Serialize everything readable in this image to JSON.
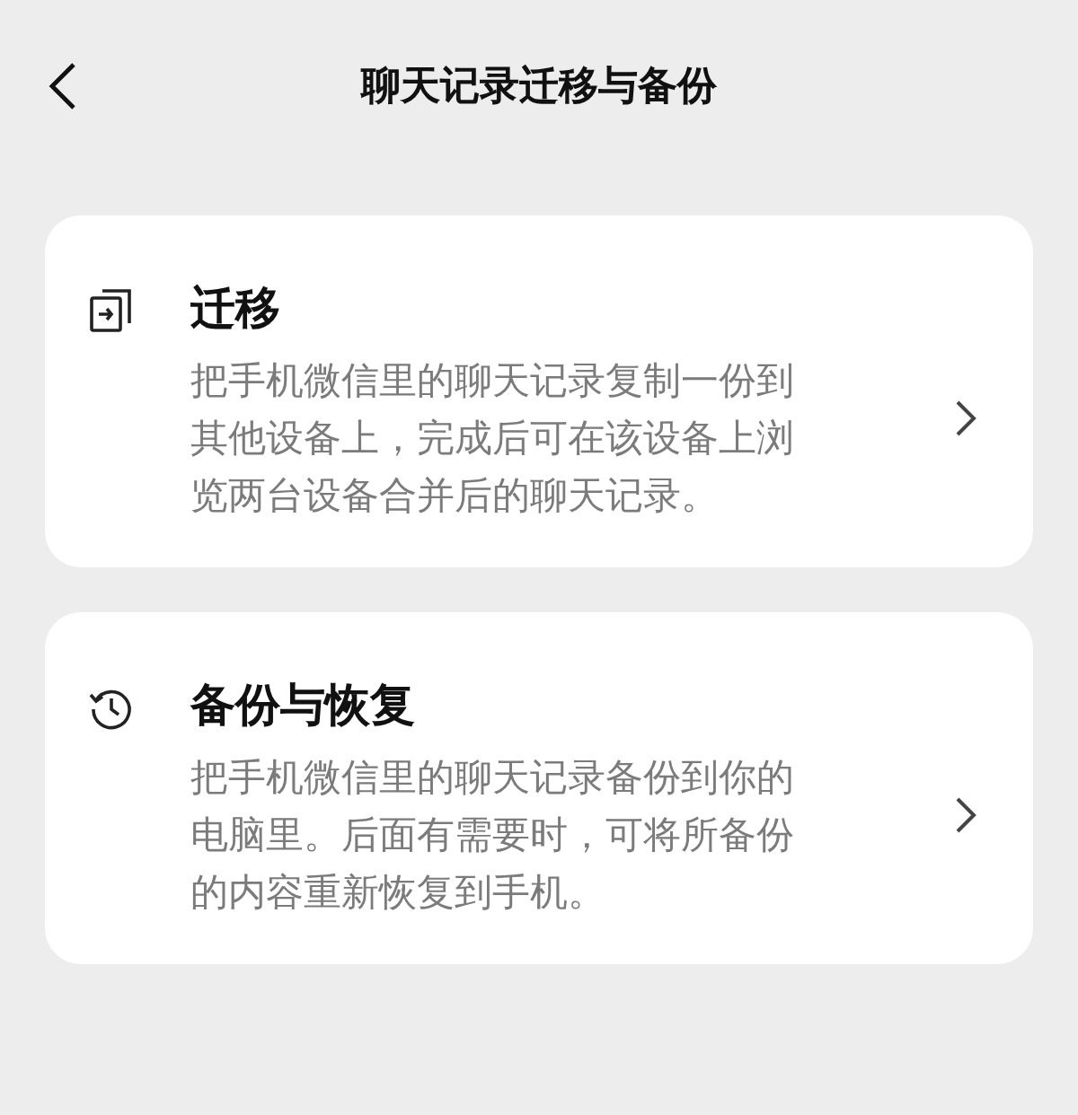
{
  "header": {
    "title": "聊天记录迁移与备份"
  },
  "options": [
    {
      "kind": "migrate",
      "title": "迁移",
      "description": "把手机微信里的聊天记录复制一份到其他设备上，完成后可在该设备上浏览两台设备合并后的聊天记录。"
    },
    {
      "kind": "history",
      "title": "备份与恢复",
      "description": "把手机微信里的聊天记录备份到你的电脑里。后面有需要时，可将所备份的内容重新恢复到手机。"
    }
  ]
}
